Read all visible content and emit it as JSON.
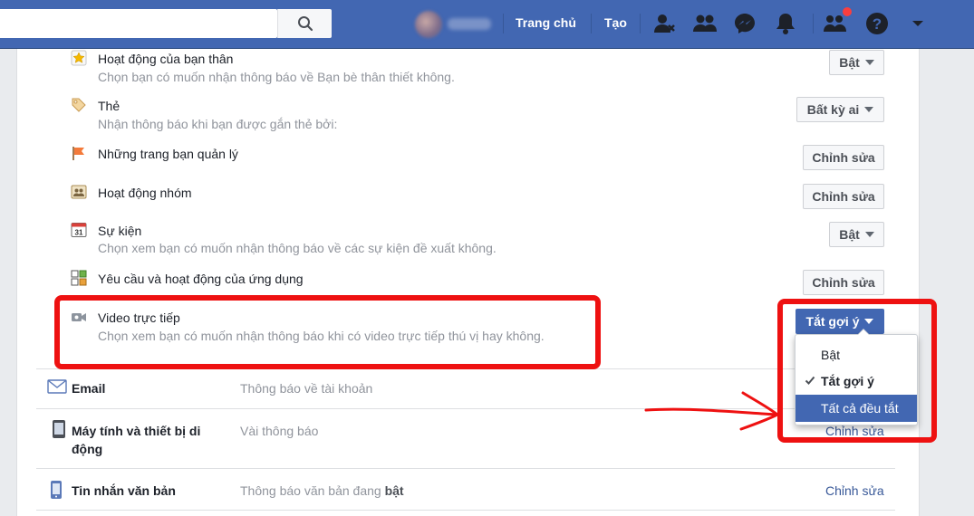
{
  "header": {
    "search": {
      "placeholder": ""
    },
    "nav": {
      "home": "Trang chủ",
      "create": "Tạo"
    }
  },
  "settings": {
    "rows": [
      {
        "title": "Hoạt động của bạn thân",
        "desc": "Chọn bạn có muốn nhận thông báo về Bạn bè thân thiết không.",
        "button": "Bật",
        "icon": "star-icon"
      },
      {
        "title": "Thẻ",
        "desc": "Nhận thông báo khi bạn được gắn thẻ bởi:",
        "button": "Bất kỳ ai",
        "icon": "tag-icon"
      },
      {
        "title": "Những trang bạn quản lý",
        "desc": "",
        "button": "Chỉnh sửa",
        "icon": "flag-icon"
      },
      {
        "title": "Hoạt động nhóm",
        "desc": "",
        "button": "Chỉnh sửa",
        "icon": "group-icon"
      },
      {
        "title": "Sự kiện",
        "desc": "Chọn xem bạn có muốn nhận thông báo về các sự kiện đề xuất không.",
        "button": "Bật",
        "icon": "calendar-icon",
        "calendar_day": "31"
      },
      {
        "title": "Yêu cầu và hoạt động của ứng dụng",
        "desc": "",
        "button": "Chỉnh sửa",
        "icon": "apps-icon"
      },
      {
        "title": "Video trực tiếp",
        "desc": "Chọn xem bạn có muốn nhận thông báo khi có video trực tiếp thú vị hay không.",
        "button": "Tắt gợi ý",
        "icon": "video-camera-icon"
      }
    ],
    "sections": [
      {
        "title": "Email",
        "desc": "Thông báo về tài khoản",
        "icon": "envelope-icon"
      },
      {
        "title": "Máy tính và thiết bị di động",
        "desc": "Vài thông báo",
        "link": "Chỉnh sửa",
        "icon": "device-icon"
      },
      {
        "title": "Tin nhắn văn bản",
        "desc_prefix": "Thông báo văn bản đang ",
        "desc_bold": "bật",
        "link": "Chỉnh sửa",
        "icon": "phone-icon"
      }
    ]
  },
  "dropdown": {
    "options": [
      "Bật",
      "Tắt gợi ý",
      "Tất cả đều tắt"
    ],
    "selected": "Tắt gợi ý",
    "highlighted": "Tất cả đều tắt"
  },
  "colors": {
    "brand": "#4267b2",
    "annotation": "#ee1111",
    "muted_text": "#90949c",
    "link": "#385898"
  }
}
